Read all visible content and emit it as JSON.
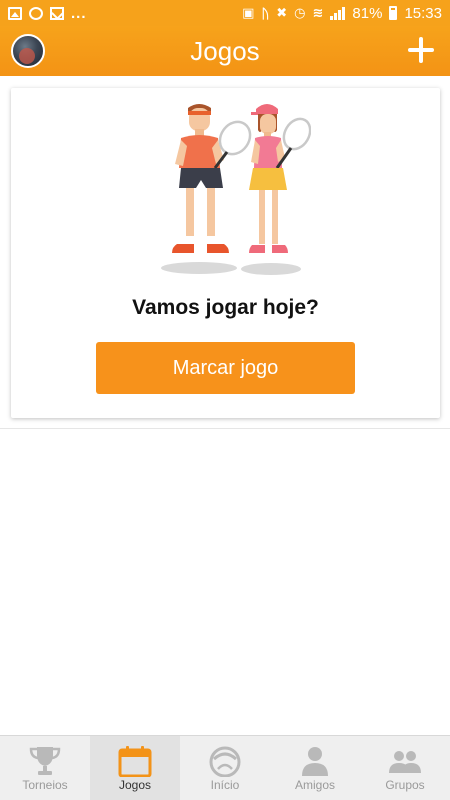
{
  "status_bar": {
    "overflow_dots": "...",
    "battery": "81%",
    "time": "15:33"
  },
  "header": {
    "title": "Jogos",
    "avatar_icon": "profile-avatar-icon",
    "add_icon": "plus-icon"
  },
  "card": {
    "illustration": "tennis-players-illustration",
    "heading": "Vamos jogar hoje?",
    "button_label": "Marcar jogo"
  },
  "bottom_nav": {
    "items": [
      {
        "label": "Torneios",
        "icon": "trophy-icon",
        "active": false
      },
      {
        "label": "Jogos",
        "icon": "calendar-icon",
        "active": true
      },
      {
        "label": "Início",
        "icon": "home-logo-icon",
        "active": false
      },
      {
        "label": "Amigos",
        "icon": "person-icon",
        "active": false
      },
      {
        "label": "Grupos",
        "icon": "people-icon",
        "active": false
      }
    ]
  },
  "colors": {
    "brand_orange": "#f7921b",
    "header_orange": "#f6a21b",
    "nav_active_orange": "#f39318"
  }
}
